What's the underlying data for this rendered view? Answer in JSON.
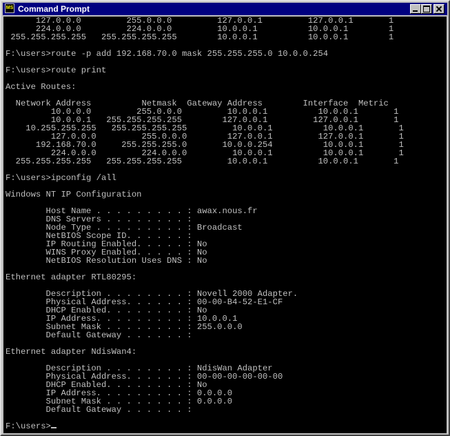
{
  "window": {
    "title": "Command Prompt",
    "icon_label": "MS"
  },
  "console": {
    "lines": [
      "      127.0.0.0         255.0.0.0         127.0.0.1         127.0.0.1       1",
      "      224.0.0.0         224.0.0.0         10.0.0.1          10.0.0.1        1",
      " 255.255.255.255   255.255.255.255        10.0.0.1          10.0.0.1        1",
      "",
      "F:\\users>route -p add 192.168.70.0 mask 255.255.255.0 10.0.0.254",
      "",
      "F:\\users>route print",
      "",
      "Active Routes:",
      "",
      "  Network Address          Netmask  Gateway Address        Interface  Metric",
      "         10.0.0.0         255.0.0.0         10.0.0.1          10.0.0.1       1",
      "         10.0.0.1   255.255.255.255        127.0.0.1         127.0.0.1       1",
      "    10.255.255.255   255.255.255.255         10.0.0.1          10.0.0.1       1",
      "         127.0.0.0         255.0.0.0        127.0.0.1         127.0.0.1       1",
      "      192.168.70.0     255.255.255.0       10.0.0.254          10.0.0.1       1",
      "         224.0.0.0         224.0.0.0         10.0.0.1          10.0.0.1       1",
      "  255.255.255.255   255.255.255.255         10.0.0.1          10.0.0.1       1",
      "",
      "F:\\users>ipconfig /all",
      "",
      "Windows NT IP Configuration",
      "",
      "        Host Name . . . . . . . . . : awax.nous.fr",
      "        DNS Servers . . . . . . . . :",
      "        Node Type . . . . . . . . . : Broadcast",
      "        NetBIOS Scope ID. . . . . . :",
      "        IP Routing Enabled. . . . . : No",
      "        WINS Proxy Enabled. . . . . : No",
      "        NetBIOS Resolution Uses DNS : No",
      "",
      "Ethernet adapter RTL80295:",
      "",
      "        Description . . . . . . . . : Novell 2000 Adapter.",
      "        Physical Address. . . . . . : 00-00-B4-52-E1-CF",
      "        DHCP Enabled. . . . . . . . : No",
      "        IP Address. . . . . . . . . : 10.0.0.1",
      "        Subnet Mask . . . . . . . . : 255.0.0.0",
      "        Default Gateway . . . . . . :",
      "",
      "Ethernet adapter NdisWan4:",
      "",
      "        Description . . . . . . . . : NdisWan Adapter",
      "        Physical Address. . . . . . : 00-00-00-00-00-00",
      "        DHCP Enabled. . . . . . . . : No",
      "        IP Address. . . . . . . . . : 0.0.0.0",
      "        Subnet Mask . . . . . . . . : 0.0.0.0",
      "        Default Gateway . . . . . . :",
      "",
      "F:\\users>"
    ]
  }
}
